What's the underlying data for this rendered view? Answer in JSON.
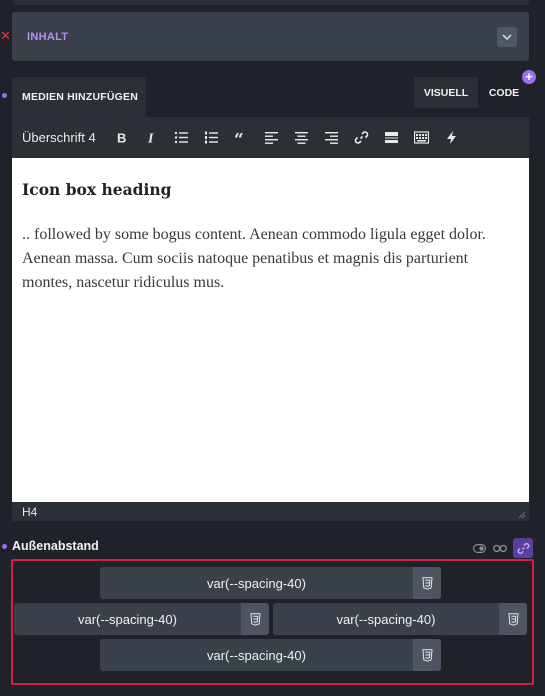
{
  "section": {
    "title": "INHALT"
  },
  "editor": {
    "add_media_label": "MEDIEN HINZUFÜGEN",
    "visual_tab": "VISUELL",
    "code_tab": "CODE",
    "format_value": "Überschrift 4",
    "content_heading": "Icon box heading",
    "content_paragraph": ".. followed by some bogus content. Aenean commodo ligula egget dolor. Aenean massa. Cum sociis natoque penatibus et magnis dis parturient montes, nascetur ridiculus mus.",
    "status_path": "H4"
  },
  "toolbar_icons": [
    "bold-icon",
    "italic-icon",
    "bullet-list-icon",
    "numbered-list-icon",
    "blockquote-icon",
    "align-left-icon",
    "align-center-icon",
    "align-right-icon",
    "link-icon",
    "read-more-icon",
    "toolbar-toggle-icon",
    "lightning-icon"
  ],
  "spacing": {
    "label": "Außenabstand",
    "top": "var(--spacing-40)",
    "left": "var(--spacing-40)",
    "right": "var(--spacing-40)",
    "bottom": "var(--spacing-40)"
  },
  "colors": {
    "accent": "#9c6ef2",
    "highlight_border": "#cf2246",
    "panel": "#2b2f36"
  }
}
